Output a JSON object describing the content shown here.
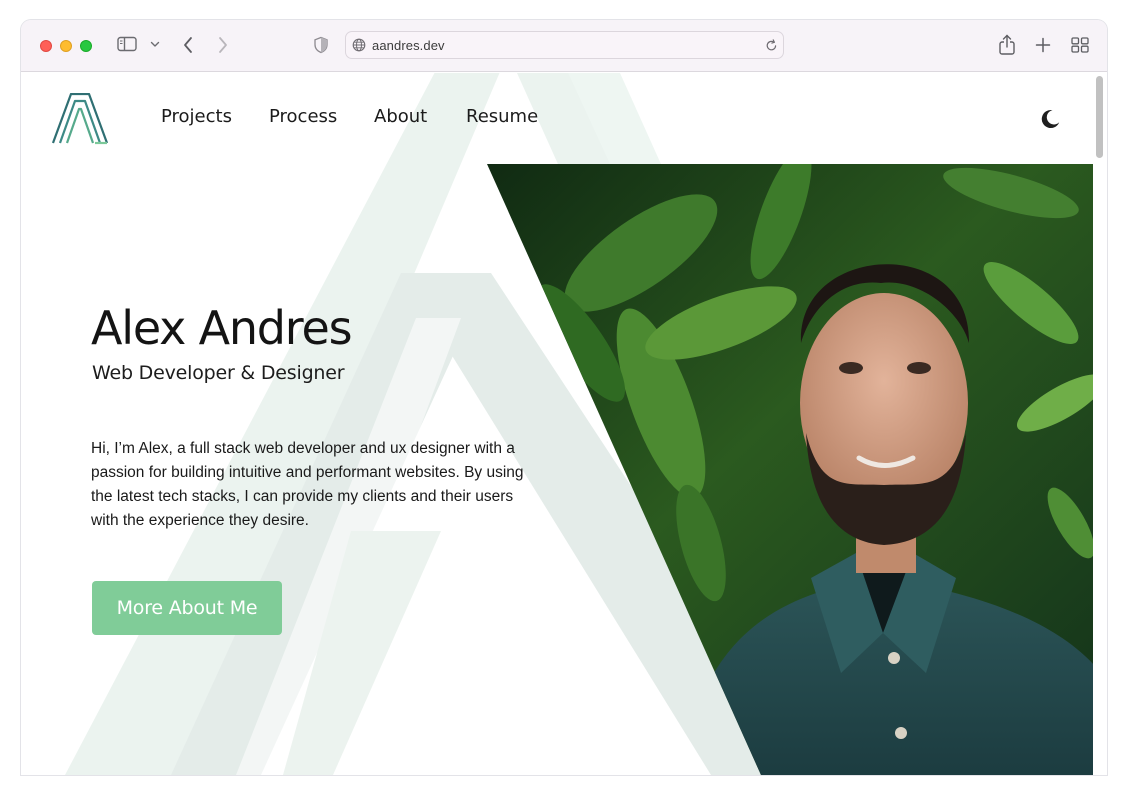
{
  "browser": {
    "url": "aandres.dev"
  },
  "nav": {
    "items": [
      {
        "label": "Projects"
      },
      {
        "label": "Process"
      },
      {
        "label": "About"
      },
      {
        "label": "Resume"
      }
    ]
  },
  "hero": {
    "name": "Alex Andres",
    "subtitle": "Web Developer & Designer",
    "description": "Hi, I’m Alex, a full stack web developer and ux designer with a passion for building intuitive and performant websites. By using the latest tech stacks, I can provide my clients and their users with the experience they desire.",
    "cta_label": "More About Me"
  },
  "colors": {
    "accent": "#80cc98",
    "logo_teal": "#2f6f73",
    "watermark": "#e4ece9"
  },
  "icons": {
    "sidebar": "sidebar-icon",
    "chevron_down": "chevron-down-icon",
    "back": "back-arrow-icon",
    "forward": "forward-arrow-icon",
    "shield": "shield-icon",
    "globe": "globe-icon",
    "reload": "reload-icon",
    "share": "share-icon",
    "new_tab": "plus-icon",
    "tab_overview": "tab-overview-icon",
    "theme": "moon-icon"
  }
}
